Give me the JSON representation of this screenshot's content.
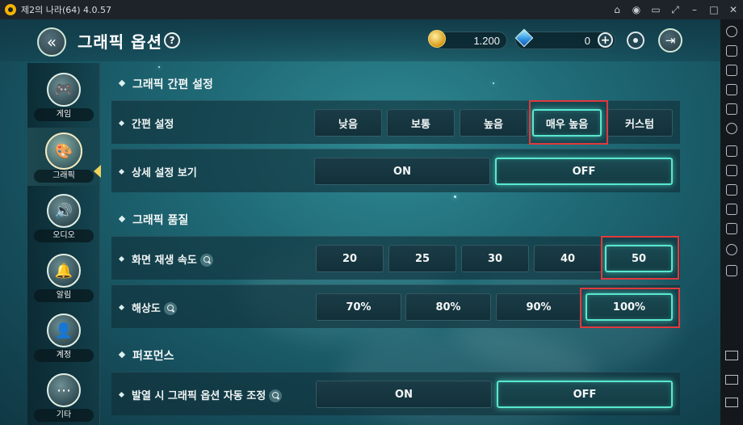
{
  "window": {
    "title": "제2의 나라(64) 4.0.57",
    "controls": [
      "gamepad-icon",
      "account-icon",
      "bookmark-icon",
      "expand-icon",
      "minimize-icon",
      "maximize-icon",
      "close-icon"
    ]
  },
  "header": {
    "title": "그래픽 옵션",
    "help": "?",
    "gold": "1.200",
    "gems": "0",
    "add_label": "+"
  },
  "sidebar": {
    "items": [
      {
        "label": "게임",
        "icon": "gamepad-icon",
        "glyph": "🎮"
      },
      {
        "label": "그래픽",
        "icon": "palette-icon",
        "glyph": "🎨"
      },
      {
        "label": "오디오",
        "icon": "speaker-icon",
        "glyph": "🔊"
      },
      {
        "label": "알림",
        "icon": "bell-icon",
        "glyph": "🔔"
      },
      {
        "label": "계정",
        "icon": "user-icon",
        "glyph": "👤"
      },
      {
        "label": "기타",
        "icon": "more-icon",
        "glyph": "⋯"
      }
    ],
    "active": "그래픽"
  },
  "sections": {
    "quick": {
      "title": "그래픽 간편 설정",
      "preset": {
        "label": "간편 설정",
        "options": [
          "낮음",
          "보통",
          "높음",
          "매우 높음",
          "커스텀"
        ],
        "selected": "매우 높음"
      },
      "detail": {
        "label": "상세 설정 보기",
        "options": [
          "ON",
          "OFF"
        ],
        "selected": "OFF"
      }
    },
    "quality": {
      "title": "그래픽 품질",
      "framerate": {
        "label": "화면 재생 속도",
        "options": [
          "20",
          "25",
          "30",
          "40",
          "50"
        ],
        "selected": "50"
      },
      "resolution": {
        "label": "해상도",
        "options": [
          "70%",
          "80%",
          "90%",
          "100%"
        ],
        "selected": "100%"
      }
    },
    "performance": {
      "title": "퍼포먼스",
      "auto_adjust": {
        "label": "발열 시 그래픽 옵션 자동 조정",
        "options": [
          "ON",
          "OFF"
        ],
        "selected": "OFF"
      }
    }
  },
  "colors": {
    "selected_glow": "#59e8d0",
    "highlight_box": "#e0393d"
  }
}
